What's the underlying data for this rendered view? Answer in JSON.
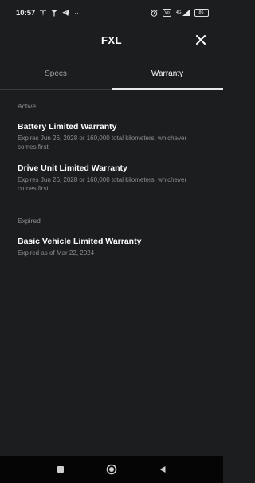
{
  "status_bar": {
    "time": "10:57",
    "more": "···",
    "volte": "Vo",
    "signal": "4G",
    "battery": "86"
  },
  "header": {
    "title": "FXL"
  },
  "tabs": [
    {
      "label": "Specs",
      "active": false
    },
    {
      "label": "Warranty",
      "active": true
    }
  ],
  "sections": {
    "active": {
      "label": "Active",
      "items": [
        {
          "title": "Battery Limited Warranty",
          "desc": "Expires Jun 26, 2028 or 160,000 total kilometers, whichever comes first"
        },
        {
          "title": "Drive Unit Limited Warranty",
          "desc": "Expires Jun 26, 2028 or 160,000 total kilometers, whichever comes first"
        }
      ]
    },
    "expired": {
      "label": "Expired",
      "items": [
        {
          "title": "Basic Vehicle Limited Warranty",
          "desc": "Expired as of Mar 22, 2024"
        }
      ]
    }
  }
}
